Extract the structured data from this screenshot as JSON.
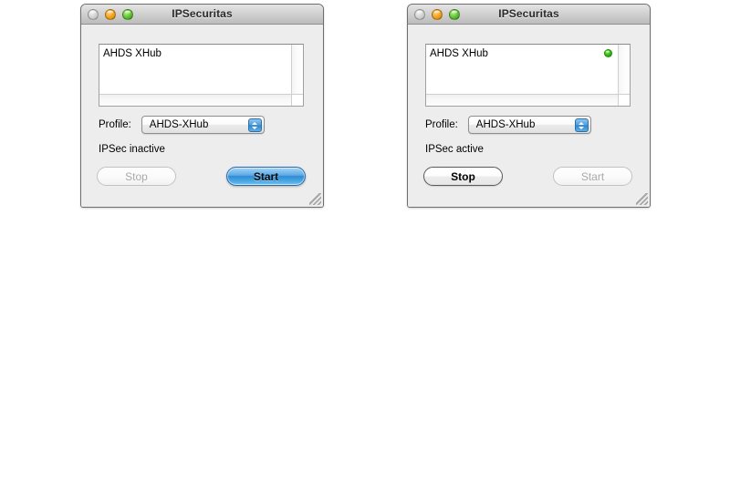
{
  "windows": [
    {
      "title": "IPSecuritas",
      "traffic": {
        "close": "close-button",
        "minimize": "minimize-button",
        "zoom": "zoom-button"
      },
      "list": {
        "rows": [
          {
            "label": "AHDS XHub",
            "has_status_dot": false,
            "dot_color": ""
          }
        ]
      },
      "profile": {
        "label": "Profile:",
        "value": "AHDS-XHub",
        "options": [
          "AHDS-XHub"
        ]
      },
      "status": "IPSec inactive",
      "buttons": {
        "stop": {
          "label": "Stop",
          "state": "disabled"
        },
        "start": {
          "label": "Start",
          "state": "default"
        }
      }
    },
    {
      "title": "IPSecuritas",
      "traffic": {
        "close": "close-button",
        "minimize": "minimize-button",
        "zoom": "zoom-button"
      },
      "list": {
        "rows": [
          {
            "label": "AHDS XHub",
            "has_status_dot": true,
            "dot_color": "#35c411"
          }
        ]
      },
      "profile": {
        "label": "Profile:",
        "value": "AHDS-XHub",
        "options": [
          "AHDS-XHub"
        ]
      },
      "status": "IPSec active",
      "buttons": {
        "stop": {
          "label": "Stop",
          "state": "enabled"
        },
        "start": {
          "label": "Start",
          "state": "disabled"
        }
      }
    }
  ],
  "colors": {
    "window_background": "#ededed",
    "titlebar_top": "#e4e4e4",
    "titlebar_bottom": "#bcbcbc",
    "default_button_blue": "#2f8ad4",
    "status_dot_green": "#35c411",
    "close_light": "#c8c8c8",
    "minimize_light": "#f2a01d",
    "zoom_light": "#5fc134"
  }
}
